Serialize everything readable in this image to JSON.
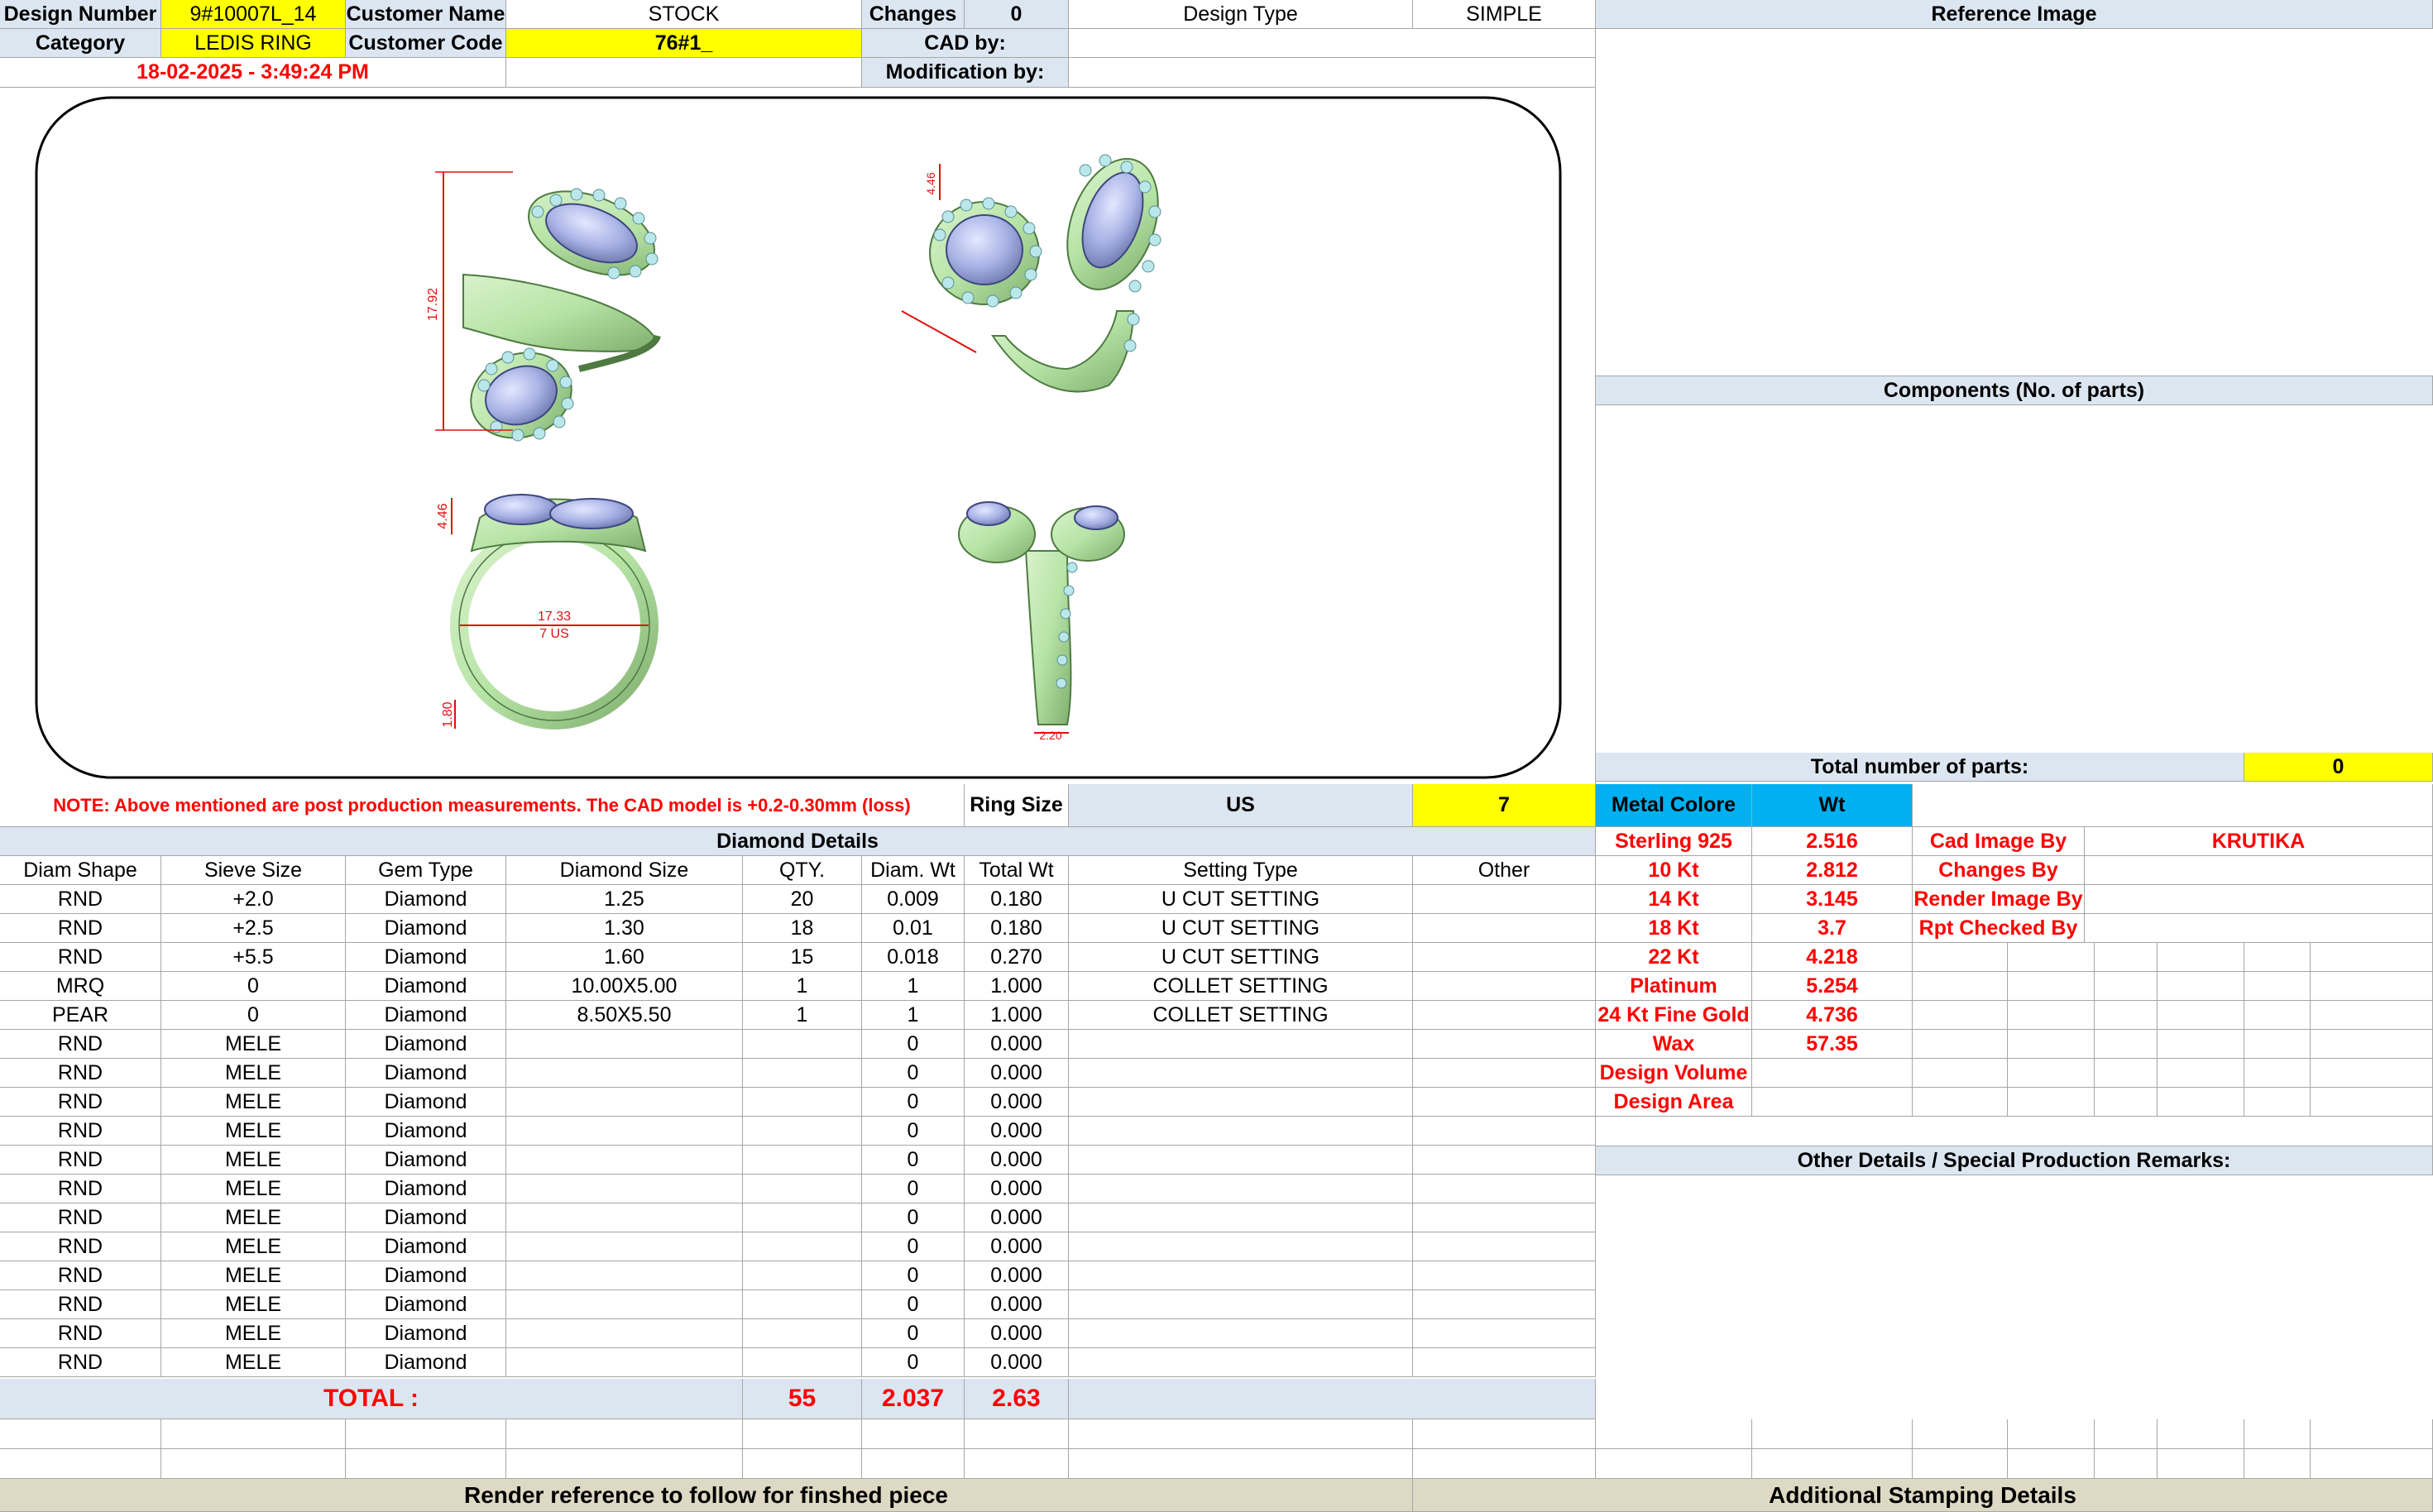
{
  "header": {
    "design_number_label": "Design Number",
    "design_number": "9#10007L_14",
    "customer_name_label": "Customer Name",
    "customer_name": "STOCK",
    "changes_label": "Changes",
    "changes": "0",
    "design_type_label": "Design Type",
    "design_type": "SIMPLE",
    "reference_image_label": "Reference Image",
    "category_label": "Category",
    "category": "LEDIS RING",
    "customer_code_label": "Customer Code",
    "customer_code": "76#1_",
    "cad_by_label": "CAD by:",
    "cad_by": "",
    "timestamp": "18-02-2025 - 3:49:24 PM",
    "modification_by_label": "Modification by:",
    "modification_by": ""
  },
  "render": {
    "dims": {
      "top_height": "17.92",
      "top_right_a": "4.46",
      "front_height": "4.46",
      "inner_diameter": "17.33",
      "ring_us": "7 US",
      "band_width": "1.80",
      "side_width": "2.20"
    }
  },
  "right_panel": {
    "components_label": "Components (No. of parts)",
    "total_parts_label": "Total number of parts:",
    "total_parts": "0",
    "other_details_label": "Other Details / Special Production Remarks:"
  },
  "note": {
    "text": "NOTE: Above mentioned are post production measurements. The CAD model is +0.2-0.30mm (loss)",
    "ring_size_label": "Ring Size",
    "ring_size_system": "US",
    "ring_size": "7"
  },
  "diamond_details": {
    "title": "Diamond Details",
    "columns": [
      "Diam Shape",
      "Sieve Size",
      "Gem Type",
      "Diamond Size",
      "QTY.",
      "Diam. Wt",
      "Total Wt",
      "Setting Type",
      "Other"
    ],
    "rows": [
      [
        "RND",
        "+2.0",
        "Diamond",
        "1.25",
        "20",
        "0.009",
        "0.180",
        "U CUT SETTING",
        ""
      ],
      [
        "RND",
        "+2.5",
        "Diamond",
        "1.30",
        "18",
        "0.01",
        "0.180",
        "U CUT SETTING",
        ""
      ],
      [
        "RND",
        "+5.5",
        "Diamond",
        "1.60",
        "15",
        "0.018",
        "0.270",
        "U CUT SETTING",
        ""
      ],
      [
        "MRQ",
        "0",
        "Diamond",
        "10.00X5.00",
        "1",
        "1",
        "1.000",
        "COLLET SETTING",
        ""
      ],
      [
        "PEAR",
        "0",
        "Diamond",
        "8.50X5.50",
        "1",
        "1",
        "1.000",
        "COLLET SETTING",
        ""
      ],
      [
        "RND",
        "MELE",
        "Diamond",
        "",
        "",
        "0",
        "0.000",
        "",
        ""
      ],
      [
        "RND",
        "MELE",
        "Diamond",
        "",
        "",
        "0",
        "0.000",
        "",
        ""
      ],
      [
        "RND",
        "MELE",
        "Diamond",
        "",
        "",
        "0",
        "0.000",
        "",
        ""
      ],
      [
        "RND",
        "MELE",
        "Diamond",
        "",
        "",
        "0",
        "0.000",
        "",
        ""
      ],
      [
        "RND",
        "MELE",
        "Diamond",
        "",
        "",
        "0",
        "0.000",
        "",
        ""
      ],
      [
        "RND",
        "MELE",
        "Diamond",
        "",
        "",
        "0",
        "0.000",
        "",
        ""
      ],
      [
        "RND",
        "MELE",
        "Diamond",
        "",
        "",
        "0",
        "0.000",
        "",
        ""
      ],
      [
        "RND",
        "MELE",
        "Diamond",
        "",
        "",
        "0",
        "0.000",
        "",
        ""
      ],
      [
        "RND",
        "MELE",
        "Diamond",
        "",
        "",
        "0",
        "0.000",
        "",
        ""
      ],
      [
        "RND",
        "MELE",
        "Diamond",
        "",
        "",
        "0",
        "0.000",
        "",
        ""
      ],
      [
        "RND",
        "MELE",
        "Diamond",
        "",
        "",
        "0",
        "0.000",
        "",
        ""
      ],
      [
        "RND",
        "MELE",
        "Diamond",
        "",
        "",
        "0",
        "0.000",
        "",
        ""
      ]
    ],
    "total_label": "TOTAL :",
    "total_qty": "55",
    "total_diam_wt": "2.037",
    "total_wt": "2.63"
  },
  "metal": {
    "metal_colore_label": "Metal Colore",
    "wt_label": "Wt",
    "rows": [
      {
        "metal": "Sterling 925",
        "wt": "2.516",
        "label": "Cad Image By",
        "value": "KRUTIKA"
      },
      {
        "metal": "10 Kt",
        "wt": "2.812",
        "label": "Changes By",
        "value": ""
      },
      {
        "metal": "14 Kt",
        "wt": "3.145",
        "label": "Render Image By",
        "value": ""
      },
      {
        "metal": "18 Kt",
        "wt": "3.7",
        "label": "Rpt Checked By",
        "value": ""
      },
      {
        "metal": "22 Kt",
        "wt": "4.218"
      },
      {
        "metal": "Platinum",
        "wt": "5.254"
      },
      {
        "metal": "24 Kt Fine Gold",
        "wt": "4.736"
      },
      {
        "metal": "Wax",
        "wt": "57.35"
      },
      {
        "metal": "Design Volume",
        "wt": ""
      },
      {
        "metal": "Design Area",
        "wt": ""
      }
    ]
  },
  "footer": {
    "render_reference": "Render reference to follow for finshed piece",
    "additional_stamping": "Additional Stamping Details"
  },
  "colors": {
    "header_blue": "#dce6f1",
    "highlight_yellow": "#ffff00",
    "metal_cyan": "#00b0f0",
    "footer_tan": "#ddd9c4",
    "alert_red": "#ff0000",
    "ring_metal_green": "#b7e4a6",
    "stone_blue": "#aab4e6"
  }
}
